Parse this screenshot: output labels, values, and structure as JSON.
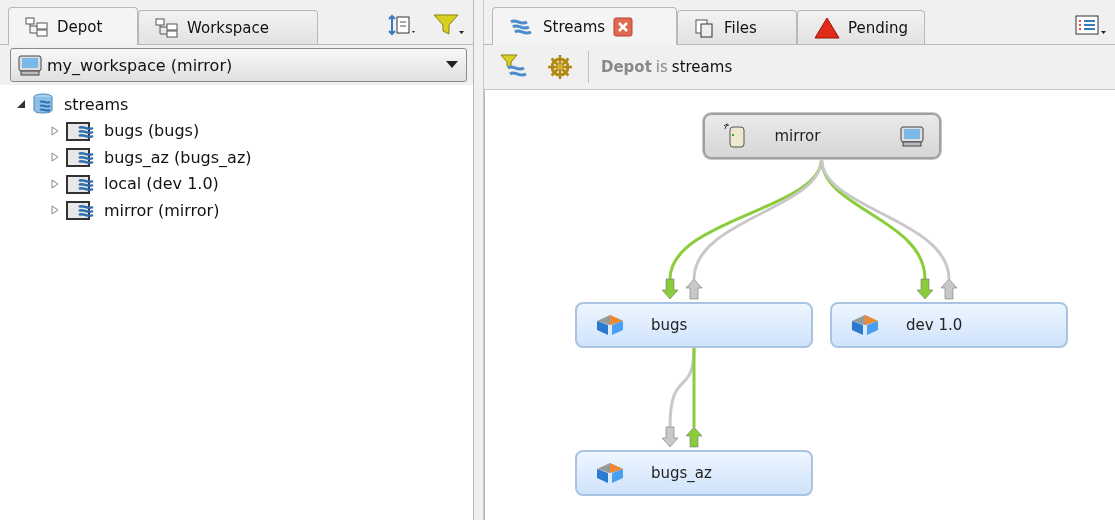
{
  "left_panel": {
    "tabs": [
      {
        "label": "Depot",
        "selected": true
      },
      {
        "label": "Workspace",
        "selected": false
      }
    ],
    "workspace_dropdown": {
      "value": "my_workspace (mirror)"
    },
    "tree": [
      {
        "label": "streams",
        "expanded": true,
        "children": [
          {
            "label": "bugs (bugs)",
            "expanded": false
          },
          {
            "label": "bugs_az (bugs_az)",
            "expanded": false
          },
          {
            "label": "local (dev 1.0)",
            "expanded": false
          },
          {
            "label": "mirror (mirror)",
            "expanded": false
          }
        ]
      }
    ]
  },
  "right_panel": {
    "tabs": [
      {
        "label": "Streams",
        "selected": true,
        "closable": true
      },
      {
        "label": "Files",
        "selected": false,
        "closable": false
      },
      {
        "label": "Pending",
        "selected": false,
        "closable": false
      }
    ],
    "filter": {
      "field": "Depot",
      "verb": "is",
      "value": "streams"
    },
    "stream_graph": [
      {
        "name": "mirror",
        "kind": "mirror",
        "children": [
          {
            "name": "bugs",
            "kind": "development",
            "merges_down": true,
            "children": [
              {
                "name": "bugs_az",
                "kind": "development",
                "merges_down": false
              }
            ]
          },
          {
            "name": "dev 1.0",
            "kind": "development",
            "merges_down": true
          }
        ]
      }
    ]
  }
}
